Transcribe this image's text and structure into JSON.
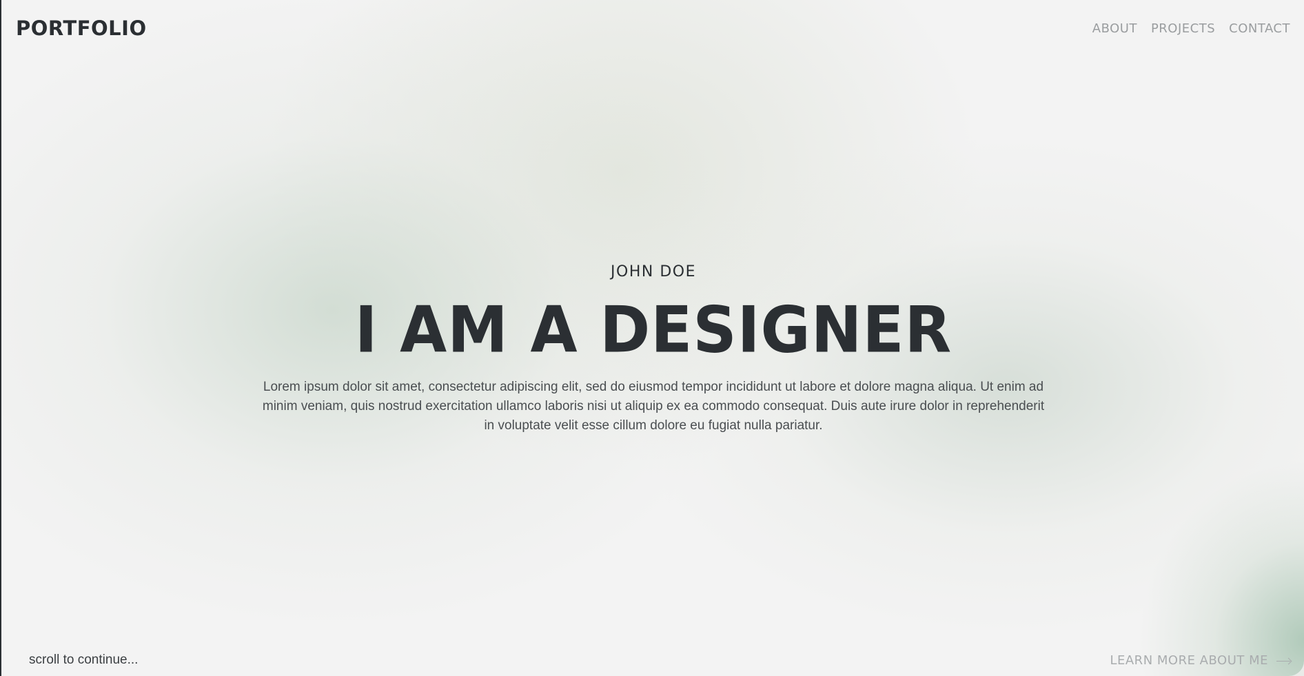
{
  "header": {
    "logo": "PORTFOLIO",
    "nav": [
      "ABOUT",
      "PROJECTS",
      "CONTACT"
    ]
  },
  "hero": {
    "eyebrow": "JOHN DOE",
    "headline": "I AM A DESIGNER",
    "lede": "Lorem ipsum dolor sit amet, consectetur adipiscing elit, sed do eiusmod tempor incididunt ut labore et dolore magna aliqua. Ut enim ad minim veniam, quis nostrud exercitation ullamco laboris nisi ut aliquip ex ea commodo consequat. Duis aute irure dolor in reprehenderit in voluptate velit esse cillum dolore eu fugiat nulla pariatur."
  },
  "footer": {
    "scroll_hint": "scroll to continue...",
    "learn_more": "LEARN MORE ABOUT ME",
    "learn_more_icon": "arrow-right-icon"
  },
  "colors": {
    "text_dark": "#2b2f33",
    "nav_muted": "#9a9d9f",
    "background": "#f3f3f3",
    "accent_green": "#a5c3b0"
  }
}
